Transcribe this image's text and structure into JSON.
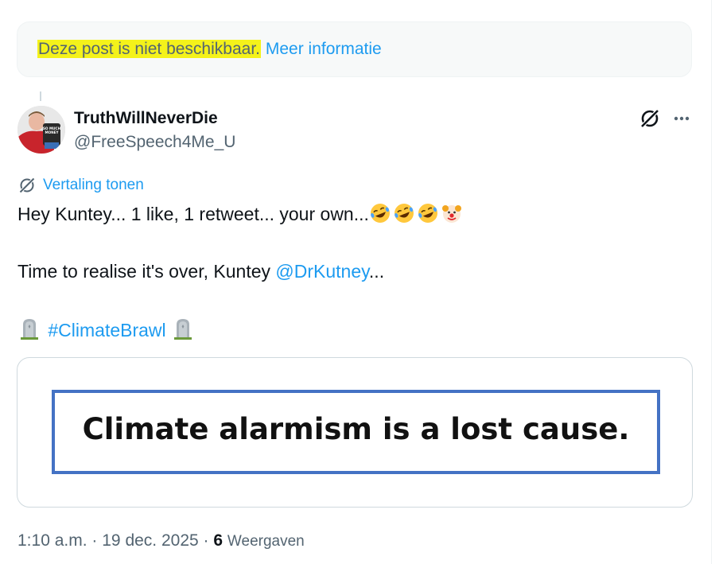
{
  "notice": {
    "unavailable_text": "Deze post is niet beschikbaar.",
    "more_info_link": "Meer informatie",
    "highlight_color": "#f4f21a"
  },
  "author": {
    "display_name": "TruthWillNeverDie",
    "handle": "@FreeSpeech4Me_U",
    "avatar_text": "SO MUCH MONEY"
  },
  "actions": {
    "grok_icon": "grok-icon",
    "more_icon": "more-dots-icon"
  },
  "translate": {
    "label": "Vertaling tonen",
    "icon": "grok-icon"
  },
  "tweet": {
    "line1_text": "Hey Kuntey... 1 like, 1 retweet... your own...",
    "line1_emojis": [
      "rolling-on-floor-laughing",
      "rolling-on-floor-laughing",
      "rolling-on-floor-laughing",
      "clown-face"
    ],
    "line2_text": "Time to realise it's over, Kuntey ",
    "line2_mention": "@DrKutney",
    "line2_suffix": "...",
    "line3_emoji_left": "headstone",
    "line3_hashtag": "#ClimateBrawl",
    "line3_emoji_right": "headstone"
  },
  "media": {
    "image_text": "Climate alarmism is a lost cause.",
    "border_color": "#4472c4"
  },
  "meta": {
    "time": "1:10 a.m.",
    "separator": "·",
    "date": "19 dec. 2025",
    "views_count": "6",
    "views_label": "Weergaven"
  },
  "colors": {
    "link": "#1d9bf0",
    "secondary_text": "#536471",
    "primary_text": "#0f1419"
  }
}
